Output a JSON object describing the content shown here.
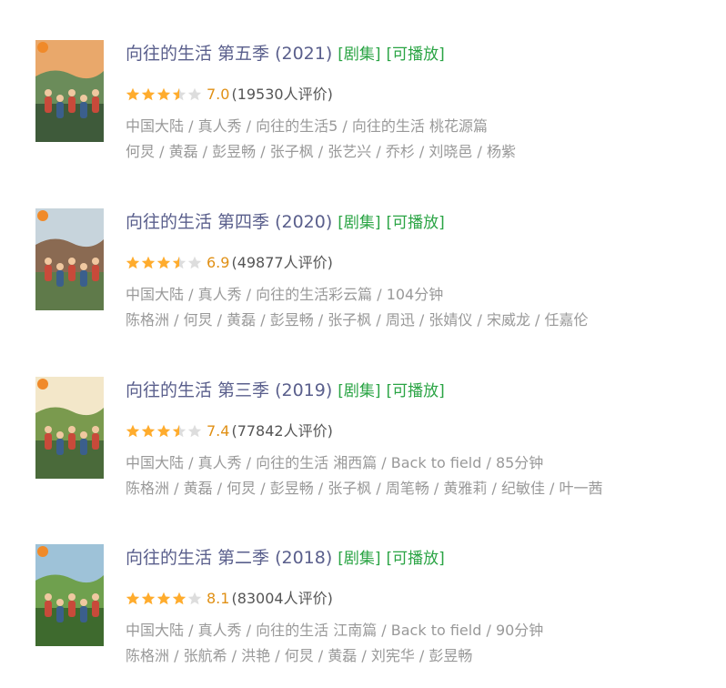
{
  "results": [
    {
      "title": "向往的生活 第五季 (2021)",
      "tag_series": "[剧集]",
      "tag_playable": "[可播放]",
      "rating": 7.0,
      "rating_text": "7.0",
      "count_text": "(19530人评价)",
      "meta": "中国大陆 / 真人秀 / 向往的生活5 / 向往的生活 桃花源篇",
      "cast": "何炅 / 黄磊 / 彭昱畅 / 张子枫 / 张艺兴 / 乔杉 / 刘晓邑 / 杨紫",
      "poster_colors": [
        "#e9a86b",
        "#6b8c5a",
        "#3e5a3a"
      ]
    },
    {
      "title": "向往的生活 第四季 (2020)",
      "tag_series": "[剧集]",
      "tag_playable": "[可播放]",
      "rating": 6.9,
      "rating_text": "6.9",
      "count_text": "(49877人评价)",
      "meta": "中国大陆 / 真人秀 / 向往的生活彩云篇 / 104分钟",
      "cast": "陈格洲 / 何炅 / 黄磊 / 彭昱畅 / 张子枫 / 周迅 / 张婧仪 / 宋威龙 / 任嘉伦",
      "poster_colors": [
        "#c7d4dc",
        "#8a6a52",
        "#5f7a4a"
      ]
    },
    {
      "title": "向往的生活 第三季 (2019)",
      "tag_series": "[剧集]",
      "tag_playable": "[可播放]",
      "rating": 7.4,
      "rating_text": "7.4",
      "count_text": "(77842人评价)",
      "meta": "中国大陆 / 真人秀 / 向往的生活 湘西篇 / Back to field / 85分钟",
      "cast": "陈格洲 / 黄磊 / 何炅 / 彭昱畅 / 张子枫 / 周笔畅 / 黄雅莉 / 纪敏佳 / 叶一茜",
      "poster_colors": [
        "#f3e7c9",
        "#7a9a4e",
        "#4a6a3a"
      ]
    },
    {
      "title": "向往的生活 第二季 (2018)",
      "tag_series": "[剧集]",
      "tag_playable": "[可播放]",
      "rating": 8.1,
      "rating_text": "8.1",
      "count_text": "(83004人评价)",
      "meta": "中国大陆 / 真人秀 / 向往的生活 江南篇 / Back to field / 90分钟",
      "cast": "陈格洲 / 张航希 / 洪艳 / 何炅 / 黄磊 / 刘宪华 / 彭昱畅",
      "poster_colors": [
        "#9ec2d8",
        "#6fa04e",
        "#3e6a2e"
      ]
    }
  ],
  "colors": {
    "title": "#5a5f8c",
    "tag": "#2aa444",
    "score": "#e09015",
    "star_full": "#ffac2d",
    "star_empty": "#dddddd",
    "meta": "#999999"
  }
}
